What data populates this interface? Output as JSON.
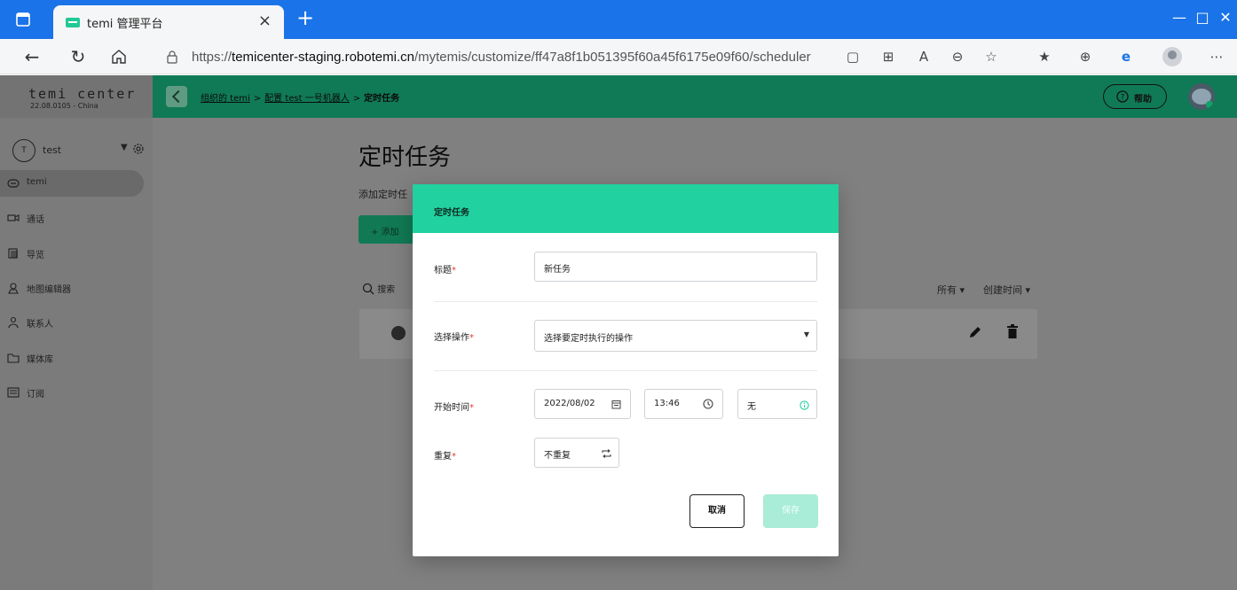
{
  "browser": {
    "tab_title": "temi 管理平台",
    "url_prefix": "https://",
    "url_host": "temicenter-staging.robotemi.cn",
    "url_path": "/mytemis/customize/ff47a8f1b051395f60a45f6175e09f60/scheduler",
    "new_tab": "+",
    "tab_close": "×"
  },
  "brand": {
    "logo": "temi center",
    "version": "22.08.0105 - China"
  },
  "user": {
    "initial": "T",
    "name": "test"
  },
  "sidebar": {
    "items": [
      {
        "label": "temi",
        "icon": "robot-icon"
      },
      {
        "label": "通话",
        "icon": "video-call-icon"
      },
      {
        "label": "导览",
        "icon": "tour-icon"
      },
      {
        "label": "地图编辑器",
        "icon": "map-editor-icon"
      },
      {
        "label": "联系人",
        "icon": "contacts-icon"
      },
      {
        "label": "媒体库",
        "icon": "folder-icon"
      },
      {
        "label": "订阅",
        "icon": "subscription-icon"
      }
    ]
  },
  "topbar": {
    "crumb_1": "组织的 temi",
    "crumb_2": "配置 test 一号机器人",
    "crumb_3": "定时任务",
    "separator": ">",
    "help": "帮助"
  },
  "page": {
    "title": "定时任务",
    "description": "添加定时任",
    "add_button": "+  添加",
    "search": "搜索",
    "filter_all": "所有",
    "sort_created": "创建时间"
  },
  "modal": {
    "title": "定时任务",
    "title_label": "标题",
    "title_value": "新任务",
    "action_label": "选择操作",
    "action_placeholder": "选择要定时执行的操作",
    "start_label": "开始时间",
    "date_value": "2022/08/02",
    "time_value": "13:46",
    "end_value": "无",
    "repeat_label": "重复",
    "repeat_value": "不重复",
    "required_mark": "*",
    "cancel": "取消",
    "save": "保存"
  },
  "colors": {
    "chrome_blue": "#1a73e8",
    "modal_header": "#21d19f",
    "save_disabled": "#a9ecd8",
    "required": "#e53935"
  }
}
